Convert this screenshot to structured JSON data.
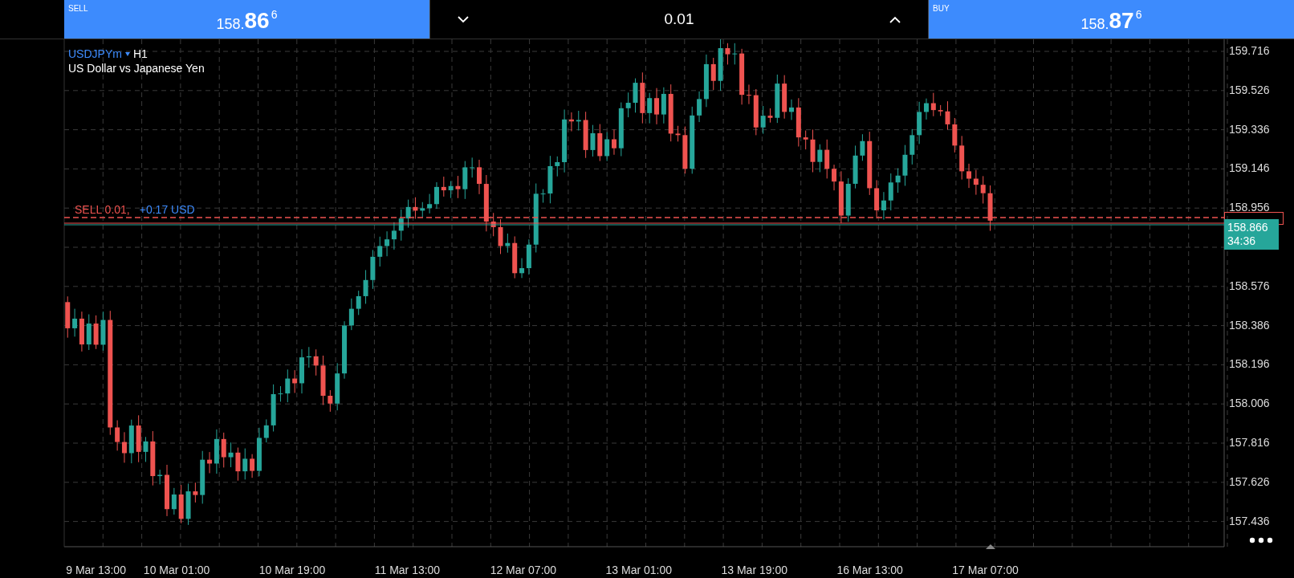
{
  "sell": {
    "label": "SELL",
    "price_small": "158.",
    "price_large": "86",
    "price_raised": "6"
  },
  "volume": {
    "value": "0.01"
  },
  "buy": {
    "label": "BUY",
    "price_small": "158.",
    "price_large": "87",
    "price_raised": "6"
  },
  "symbol": {
    "ticker": "USDJPYm",
    "timeframe": "H1",
    "description": "US Dollar vs Japanese Yen"
  },
  "position": {
    "side": "SELL 0.01,",
    "profit": "+0.17 USD"
  },
  "price_axis": [
    "159.716",
    "159.526",
    "159.336",
    "159.146",
    "158.956",
    "158.576",
    "158.386",
    "158.196",
    "158.006",
    "157.816",
    "157.626",
    "157.436"
  ],
  "current_price": {
    "price": "158.866",
    "countdown": "34:36"
  },
  "time_axis": [
    "9 Mar 13:00",
    "10 Mar 01:00",
    "10 Mar 19:00",
    "11 Mar 13:00",
    "12 Mar 07:00",
    "13 Mar 01:00",
    "13 Mar 19:00",
    "16 Mar 13:00",
    "17 Mar 07:00"
  ]
}
